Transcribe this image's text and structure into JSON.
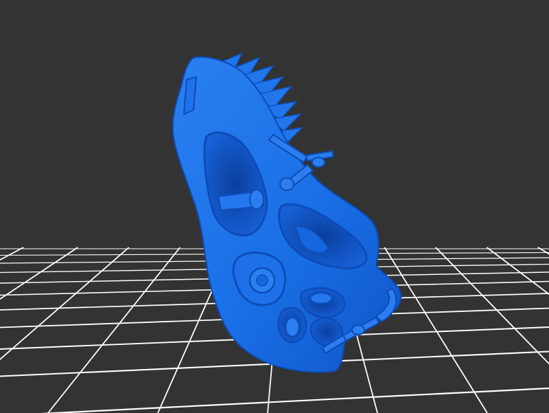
{
  "viewport": {
    "background": "#333333",
    "grid_color": "#ffffff",
    "grid_visible": true,
    "model": {
      "name": "3d-mesh-model",
      "color": "#1a6fe6",
      "shade_dark": "#0e4fbf",
      "shade_light": "#3d8cf5"
    }
  }
}
